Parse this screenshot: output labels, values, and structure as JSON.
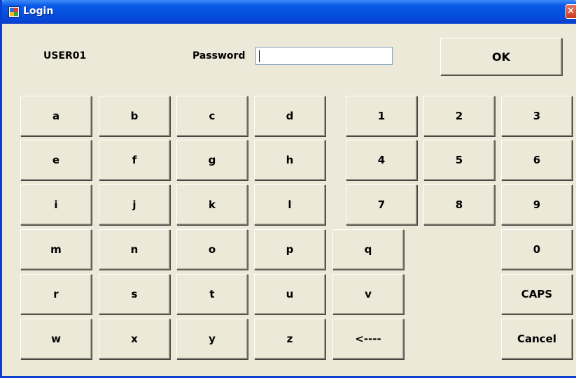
{
  "window": {
    "title": "Login"
  },
  "user_label": "USER01",
  "password": {
    "label": "Password",
    "value": "",
    "placeholder": ""
  },
  "ok_label": "OK",
  "letter_keys": {
    "row1": [
      "a",
      "b",
      "c",
      "d"
    ],
    "row2": [
      "e",
      "f",
      "g",
      "h"
    ],
    "row3": [
      "i",
      "j",
      "k",
      "l"
    ],
    "row4": [
      "m",
      "n",
      "o",
      "p",
      "q"
    ],
    "row5": [
      "r",
      "s",
      "t",
      "u",
      "v"
    ],
    "row6": [
      "w",
      "x",
      "y",
      "z"
    ]
  },
  "backspace_label": "<----",
  "number_keys": {
    "row1": [
      "1",
      "2",
      "3"
    ],
    "row2": [
      "4",
      "5",
      "6"
    ],
    "row3": [
      "7",
      "8",
      "9"
    ],
    "zero": "0"
  },
  "caps_label": "CAPS",
  "cancel_label": "Cancel",
  "colors": {
    "title_bar": "#0a58e6",
    "dialog_background": "#ece9d8",
    "close_button": "#c9381c"
  }
}
